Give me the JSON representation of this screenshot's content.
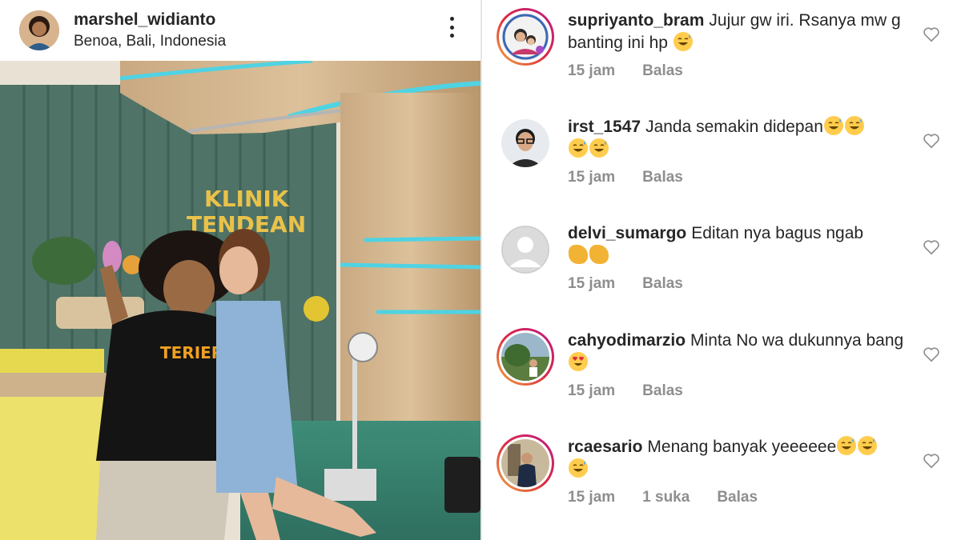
{
  "post": {
    "username": "marshel_widianto",
    "location": "Benoa, Bali, Indonesia",
    "photo": {
      "sign_line1": "KLINIK",
      "sign_line2": "TENDEAN",
      "shirt_text": "TERIER"
    }
  },
  "comments": [
    {
      "username": "supriyanto_bram",
      "text": "Jujur gw iri. Rsanya mw g banting ini hp",
      "emojis": [
        "grinning-sweat"
      ],
      "time": "15 jam",
      "likes": "",
      "reply_label": "Balas",
      "story_ring": true,
      "avatar_icon": "family-photo-avatar"
    },
    {
      "username": "irst_1547",
      "text": "Janda semakin didepan",
      "emojis": [
        "grinning-sweat",
        "grinning-sweat",
        "grinning-sweat",
        "grinning-sweat"
      ],
      "time": "15 jam",
      "likes": "",
      "reply_label": "Balas",
      "story_ring": false,
      "avatar_icon": "man-glasses-avatar"
    },
    {
      "username": "delvi_sumargo",
      "text": "Editan nya bagus ngab",
      "emojis": [
        "clapping-hands",
        "clapping-hands"
      ],
      "time": "15 jam",
      "likes": "",
      "reply_label": "Balas",
      "story_ring": false,
      "avatar_icon": "default-user-avatar"
    },
    {
      "username": "cahyodimarzio",
      "text": "Minta No wa dukunnya bang",
      "emojis": [
        "heart-eyes"
      ],
      "time": "15 jam",
      "likes": "",
      "reply_label": "Balas",
      "story_ring": true,
      "avatar_icon": "outdoor-photo-avatar"
    },
    {
      "username": "rcaesario",
      "text": "Menang banyak yeeeeee",
      "emojis": [
        "grinning-sweat",
        "grinning-sweat",
        "grinning-sweat"
      ],
      "time": "15 jam",
      "likes": "1 suka",
      "reply_label": "Balas",
      "story_ring": true,
      "avatar_icon": "suit-man-avatar"
    }
  ],
  "colors": {
    "text_primary": "#262626",
    "text_secondary": "#8e8e8e",
    "story_ring": "#dc2743"
  }
}
